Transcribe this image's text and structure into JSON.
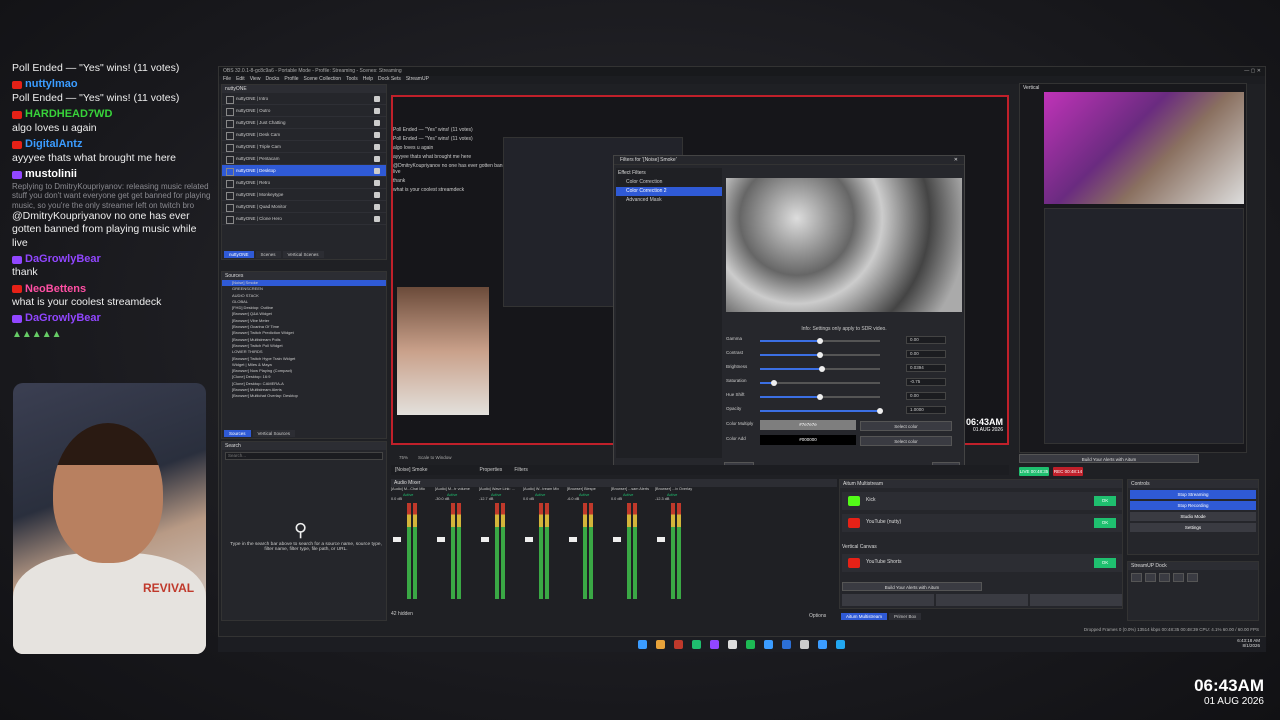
{
  "colors": {
    "youtube": "#e62117",
    "twitch": "#9146ff",
    "accent": "#2f5ad6",
    "record": "#c0202a",
    "green": "#1fbf6f"
  },
  "chat": {
    "messages": [
      {
        "platform": "youtube",
        "user": "",
        "user_color": "#3b9cff",
        "text": "Poll Ended — \"Yes\" wins! (11 votes)"
      },
      {
        "platform": "youtube",
        "user": "nuttylmao",
        "user_color": "#3b9cff",
        "text": "Poll Ended — \"Yes\" wins! (11 votes)"
      },
      {
        "platform": "youtube",
        "user": "HARDHEAD7WD",
        "user_color": "#38d33a",
        "text": "algo loves u again"
      },
      {
        "platform": "youtube",
        "user": "DigitalAntz",
        "user_color": "#3b9cff",
        "text": "ayyyee thats what brought me here"
      },
      {
        "platform": "twitch",
        "user": "mustolinii",
        "user_color": "#ffffff",
        "reply": "Replying to DmitryKoupriyanov: releasing music related stuff you don't want everyone get get banned for playing music, so you're the only streamer left on twitch bro",
        "text": "@DmitryKoupriyanov no one has ever gotten banned from playing music while live"
      },
      {
        "platform": "twitch",
        "user": "DaGrowlyBear",
        "user_color": "#9146ff",
        "text": "thank"
      },
      {
        "platform": "youtube",
        "user": "NeoBettens",
        "user_color": "#ff4fa3",
        "text": "what is your coolest streamdeck"
      },
      {
        "platform": "twitch",
        "user": "DaGrowlyBear",
        "user_color": "#9146ff",
        "text": ""
      }
    ]
  },
  "webcam": {
    "shirt": "REVIVAL"
  },
  "obs": {
    "title": "OBS 32.0.1-8-gc8c9a6 - Portable Mode - Profile: Streaming - Scenes: Streaming",
    "menu": [
      "File",
      "Edit",
      "View",
      "Docks",
      "Profile",
      "Scene Collection",
      "Tools",
      "Help",
      "Dock Sets",
      "StreamUP"
    ],
    "scenes_header": "nuttyONE",
    "scenes": [
      "nuttyONE | Intro",
      "nuttyONE | Outro",
      "nuttyONE | Just Chatting",
      "nuttyONE | Desk Cam",
      "nuttyONE | Triple Cam",
      "nuttyONE | Pentacam",
      "nuttyONE | Desktop",
      "nuttyONE | Retro",
      "nuttyONE | Monkeytype",
      "nuttyONE | Quad Monitor",
      "nuttyONE | Clone Hero"
    ],
    "scene_tabs": [
      "nuttyONE",
      "Scenes",
      "Vertical Scenes"
    ],
    "sources_header": "Sources",
    "sources": [
      "[Noise] Smoke",
      "GREENSCREEN",
      "AUDIO STACK",
      "GLOBAL",
      "[FHD] Desktop: Outline",
      "[Browser] Q&A Widget",
      "[Browser] Vibe Meter",
      "[Browser] Ocarina Of Time",
      "[Browser] Twitch Prediction Widget",
      "[Browser] Multistream Polls",
      "[Browser] Twitch Poll Widget",
      "LOWER THIRDS",
      "[Browser] Twitch Hype Train Widget",
      "Widget | Miles & Maya",
      "[Browser] Now Playing (Compact)",
      "[Clone] Desktop: 16:9",
      "[Clone] Desktop: CAMERA-A",
      "[Browser] Multistream Alerts",
      "[Browser] Multichat Overlay: Desktop"
    ],
    "source_tabs": [
      "Sources",
      "Vertical Sources"
    ],
    "search_header": "Search",
    "search_placeholder": "Search...",
    "search_help": "Type in the search bar above to search for a source name, source type, filter name, filter type, file path, or URL.",
    "filters": {
      "title": "Filters for '[Noise] Smoke'",
      "effect_filters": "Effect Filters",
      "list": [
        "Color Correction",
        "Color Correction 2",
        "Advanced Mask"
      ],
      "selected": 1,
      "info": "Info: Settings only apply to SDR video.",
      "sliders": [
        {
          "label": "Gamma",
          "value": "0.00",
          "frac": 0.5
        },
        {
          "label": "Contrast",
          "value": "0.00",
          "frac": 0.5
        },
        {
          "label": "Brightness",
          "value": "0.0394",
          "frac": 0.52
        },
        {
          "label": "Saturation",
          "value": "-0.75",
          "frac": 0.12
        },
        {
          "label": "Hue Shift",
          "value": "0.00",
          "frac": 0.5
        },
        {
          "label": "Opacity",
          "value": "1.0000",
          "frac": 1.0
        }
      ],
      "color_multiply_label": "Color Multiply",
      "color_multiply": "#7e7e7e",
      "color_add_label": "Color Add",
      "color_add": "#000000",
      "select_color": "Select color",
      "defaults": "Defaults",
      "close": "Close"
    },
    "preview_clock": "06:43AM",
    "preview_sub": "01 AUG 2026",
    "source_toolbar": {
      "name": "[Noise] Smoke",
      "properties": "Properties",
      "filters": "Filters"
    },
    "zoom": {
      "label": "75%",
      "mode": "Scale to Window"
    },
    "vertical": {
      "title": "Vertical",
      "alerts_btn": "Build Your Alerts with Aitum"
    },
    "mixer": {
      "title": "Audio Mixer",
      "hidden": "42 hidden",
      "channels": [
        {
          "name": "[Audio] M...Chat Mic",
          "db": "0.0 dB",
          "status": "Active"
        },
        {
          "name": "[Audio] M...tr volume",
          "db": "-30.0 dB",
          "status": "Active"
        },
        {
          "name": "[Audio] Wave Link: ...",
          "db": "-12.7 dB",
          "status": "Active"
        },
        {
          "name": "[Audio] W...tream Mix",
          "db": "0.0 dB",
          "status": "Active"
        },
        {
          "name": "[Browser] Blespe",
          "db": "-6.0 dB",
          "status": "Active"
        },
        {
          "name": "[Browser] ...sam Alerts",
          "db": "0.0 dB",
          "status": "Active"
        },
        {
          "name": "[Browser] ...ix Overlay",
          "db": "-12.3 dB",
          "status": "Active"
        }
      ]
    },
    "status_row": {
      "live": "LIVE 00:48:35",
      "rec": "REC 00:48:14"
    },
    "multistream": {
      "title": "Aitum Multistream",
      "rows": [
        {
          "name": "Kick",
          "btn": "OK"
        },
        {
          "name": "YouTube (nutty)",
          "btn": "OK"
        }
      ],
      "vertical_title": "Vertical Canvas",
      "vertical_rows": [
        {
          "name": "YouTube Shorts",
          "btn": "OK"
        }
      ],
      "alerts_btn": "Build Your Alerts with Aitum",
      "tabs": [
        "Aitum Multistream",
        "Primer Box"
      ]
    },
    "controls": {
      "title": "Controls",
      "buttons": [
        "Stop Streaming",
        "Stop Recording",
        "Studio Mode",
        "Settings"
      ]
    },
    "streamup": {
      "title": "StreamUP Dock"
    },
    "options": "Options",
    "statusbar": "Dropped Frames 0 (0.0%)   13514 kbps   00:48:35   00:48:39   CPU: 4.1%  60.00 / 60.00 FPS"
  },
  "taskbar": {
    "time": "6:43:18 AM",
    "date": "8/1/2026"
  },
  "overlay_clock": {
    "time": "06:43AM",
    "date": "01 AUG 2026"
  }
}
